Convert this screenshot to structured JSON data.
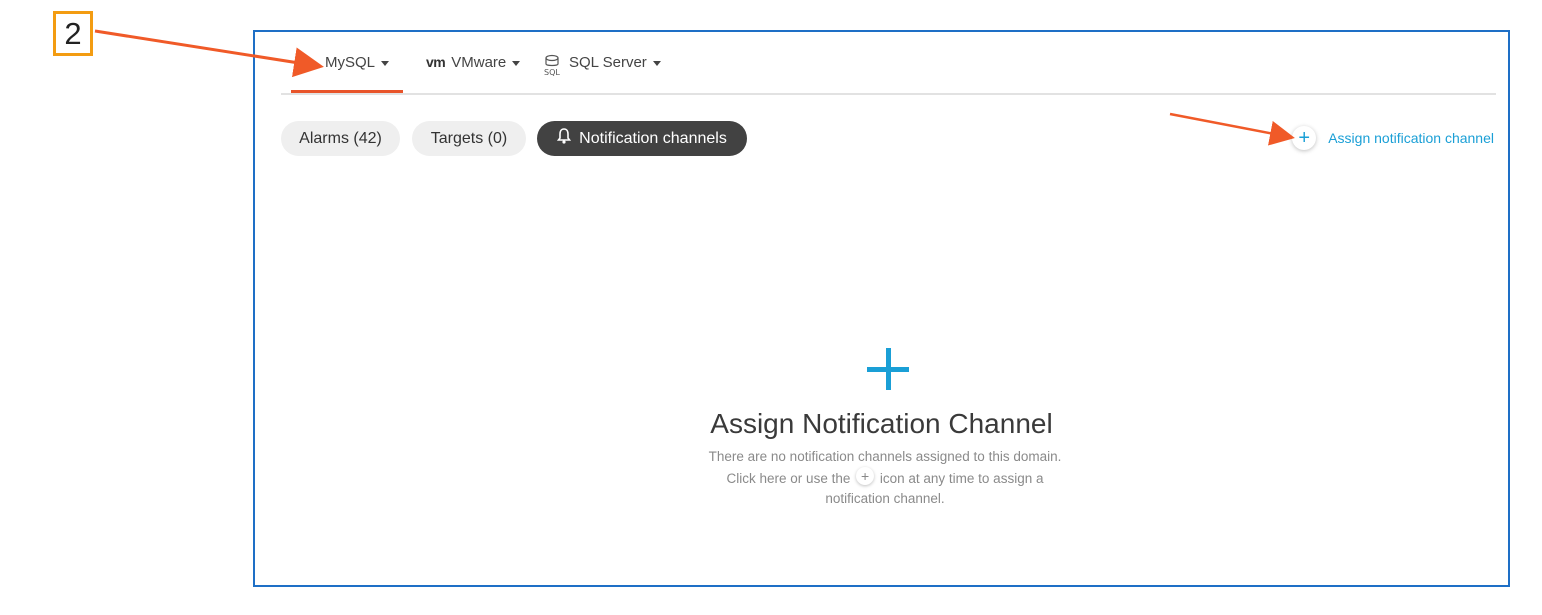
{
  "callout": {
    "number": "2"
  },
  "tabs": [
    {
      "icon": "mysql-dolphin-icon",
      "label": "MySQL",
      "active": true
    },
    {
      "icon": "vmware-logo-icon",
      "icon_text": "vm",
      "label": "VMware",
      "active": false
    },
    {
      "icon": "sql-database-icon",
      "label": "SQL Server",
      "active": false
    }
  ],
  "pills": {
    "alarms": "Alarms (42)",
    "targets": "Targets (0)",
    "channels": "Notification channels"
  },
  "assign_link": {
    "label": "Assign notification channel"
  },
  "empty_state": {
    "title": "Assign Notification Channel",
    "line1": "There are no notification channels assigned to this domain.",
    "line2_pre": "Click here or use the",
    "line2_post": "icon at any time to assign a",
    "line3": "notification channel."
  },
  "colors": {
    "accent": "#1a9fd6",
    "active_tab_underline": "#e8542a",
    "frame_border": "#1e6fc6",
    "callout_border": "#f39c12",
    "annotation_arrow": "#f05a28"
  }
}
